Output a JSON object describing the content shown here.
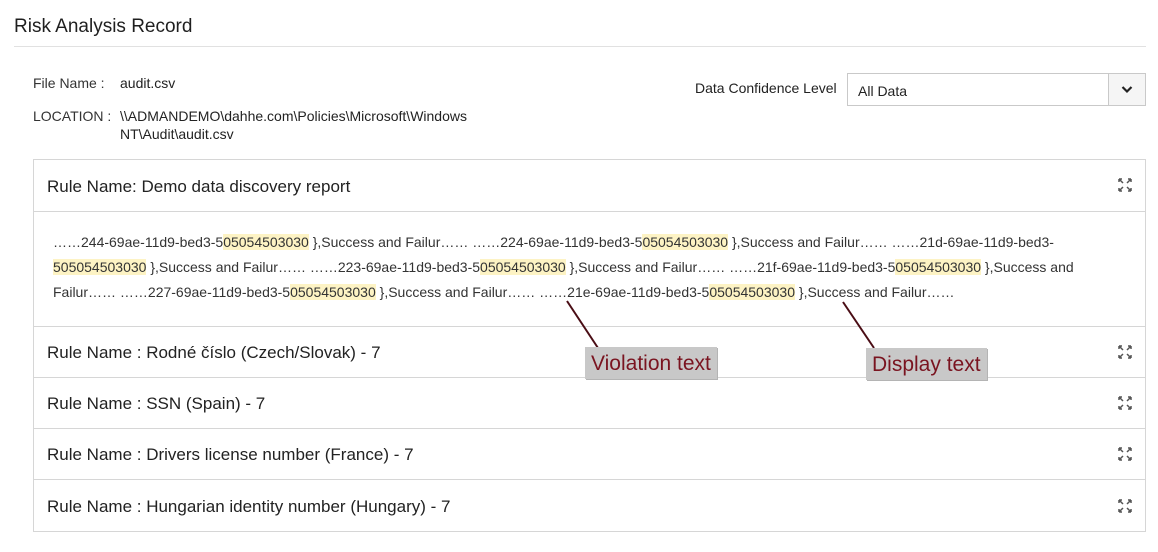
{
  "page_title": "Risk Analysis Record",
  "file": {
    "name_label": "File Name :",
    "name_value": "audit.csv",
    "location_label": "LOCATION :",
    "location_line1": "\\\\ADMANDEMO\\dahhe.com\\Policies\\Microsoft\\Windows",
    "location_line2": "NT\\Audit\\audit.csv"
  },
  "confidence": {
    "label": "Data Confidence Level",
    "selected": "All Data"
  },
  "rules": [
    {
      "title": "Rule Name: Demo data discovery report"
    },
    {
      "title": "Rule Name : Rodné číslo (Czech/Slovak) - 7"
    },
    {
      "title": "Rule Name : SSN (Spain) - 7"
    },
    {
      "title": "Rule Name : Drivers license number (France) - 7"
    },
    {
      "title": "Rule Name : Hungarian identity number (Hungary) - 7"
    }
  ],
  "matches": [
    {
      "pre": "……244-69ae-11d9-bed3-5",
      "hl": "05054503030",
      "post": " },Success and Failur…… "
    },
    {
      "pre": "……224-69ae-11d9-bed3-5",
      "hl": "05054503030",
      "post": " },Success and Failur…… "
    },
    {
      "pre": "……21d-69ae-11d9-bed3-",
      "hl": "505054503030",
      "post": " },Success and Failur…… "
    },
    {
      "pre": "……223-69ae-11d9-bed3-5",
      "hl": "05054503030",
      "post": " },Success and Failur…… "
    },
    {
      "pre": "……21f-69ae-11d9-bed3-5",
      "hl": "05054503030",
      "post": " },Success and Failur…… "
    },
    {
      "pre": "……227-69ae-11d9-bed3-5",
      "hl": "05054503030",
      "post": " },Success and Failur…… "
    },
    {
      "pre": "……21e-69ae-11d9-bed3-5",
      "hl": "05054503030",
      "post": " },Success and Failur……"
    }
  ],
  "callouts": {
    "violation": "Violation text",
    "display": "Display text"
  },
  "colors": {
    "highlight": "#fdf3c4",
    "callout_bg": "#c8c8c8",
    "callout_text": "#7a1420"
  },
  "icons": {
    "dropdown": "chevron-down-icon",
    "expand": "expand-icon"
  }
}
